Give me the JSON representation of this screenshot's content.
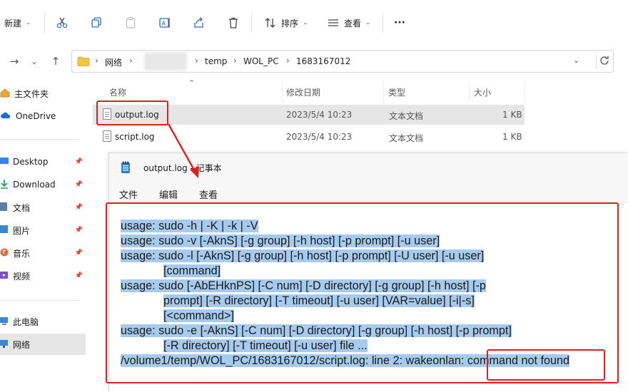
{
  "toolbar": {
    "new_label": "新建",
    "sort_label": "排序",
    "view_label": "查看",
    "more_label": "···"
  },
  "breadcrumb": {
    "items": [
      "网络",
      "temp",
      "WOL_PC",
      "1683167012"
    ]
  },
  "sidebar": {
    "items": [
      {
        "label": "主文件夹"
      },
      {
        "label": "OneDrive"
      },
      {
        "label": "Desktop"
      },
      {
        "label": "Download"
      },
      {
        "label": "文档"
      },
      {
        "label": "图片"
      },
      {
        "label": "音乐"
      },
      {
        "label": "视频"
      },
      {
        "label": "此电脑"
      },
      {
        "label": "网络"
      }
    ]
  },
  "file_list": {
    "columns": [
      "名称",
      "修改日期",
      "类型",
      "大小"
    ],
    "rows": [
      {
        "name": "output.log",
        "date": "2023/5/4 10:23",
        "type": "文本文档",
        "size": "1 KB"
      },
      {
        "name": "script.log",
        "date": "2023/5/4 10:23",
        "type": "文本文档",
        "size": "1 KB"
      }
    ]
  },
  "notepad": {
    "title": "output.log - 记事本",
    "menu": [
      "文件",
      "编辑",
      "查看"
    ],
    "lines": [
      {
        "text": "usage: sudo -h | -K | -k | -V",
        "indent": false
      },
      {
        "text": "usage: sudo -v [-AknS] [-g group] [-h host] [-p prompt] [-u user]",
        "indent": false
      },
      {
        "text": "usage: sudo -l [-AknS] [-g group] [-h host] [-p prompt] [-U user] [-u user]",
        "indent": false
      },
      {
        "text": "[command]",
        "indent": true
      },
      {
        "text": "usage: sudo [-AbEHknPS] [-C num] [-D directory] [-g group] [-h host] [-p",
        "indent": false
      },
      {
        "text": "prompt] [-R directory] [-T timeout] [-u user] [VAR=value] [-i|-s]",
        "indent": true
      },
      {
        "text": "[<command>]",
        "indent": true
      },
      {
        "text": "usage: sudo -e [-AknS] [-C num] [-D directory] [-g group] [-h host] [-p prompt]",
        "indent": false
      },
      {
        "text": "[-R directory] [-T timeout] [-u user] file ...",
        "indent": true
      },
      {
        "text": "/volume1/temp/WOL_PC/1683167012/script.log: line 2: wakeonlan: command not found",
        "indent": false
      }
    ]
  },
  "colors": {
    "highlight": "#a6cbef",
    "callout": "#e0201f",
    "selection": "#e6e6e6"
  }
}
